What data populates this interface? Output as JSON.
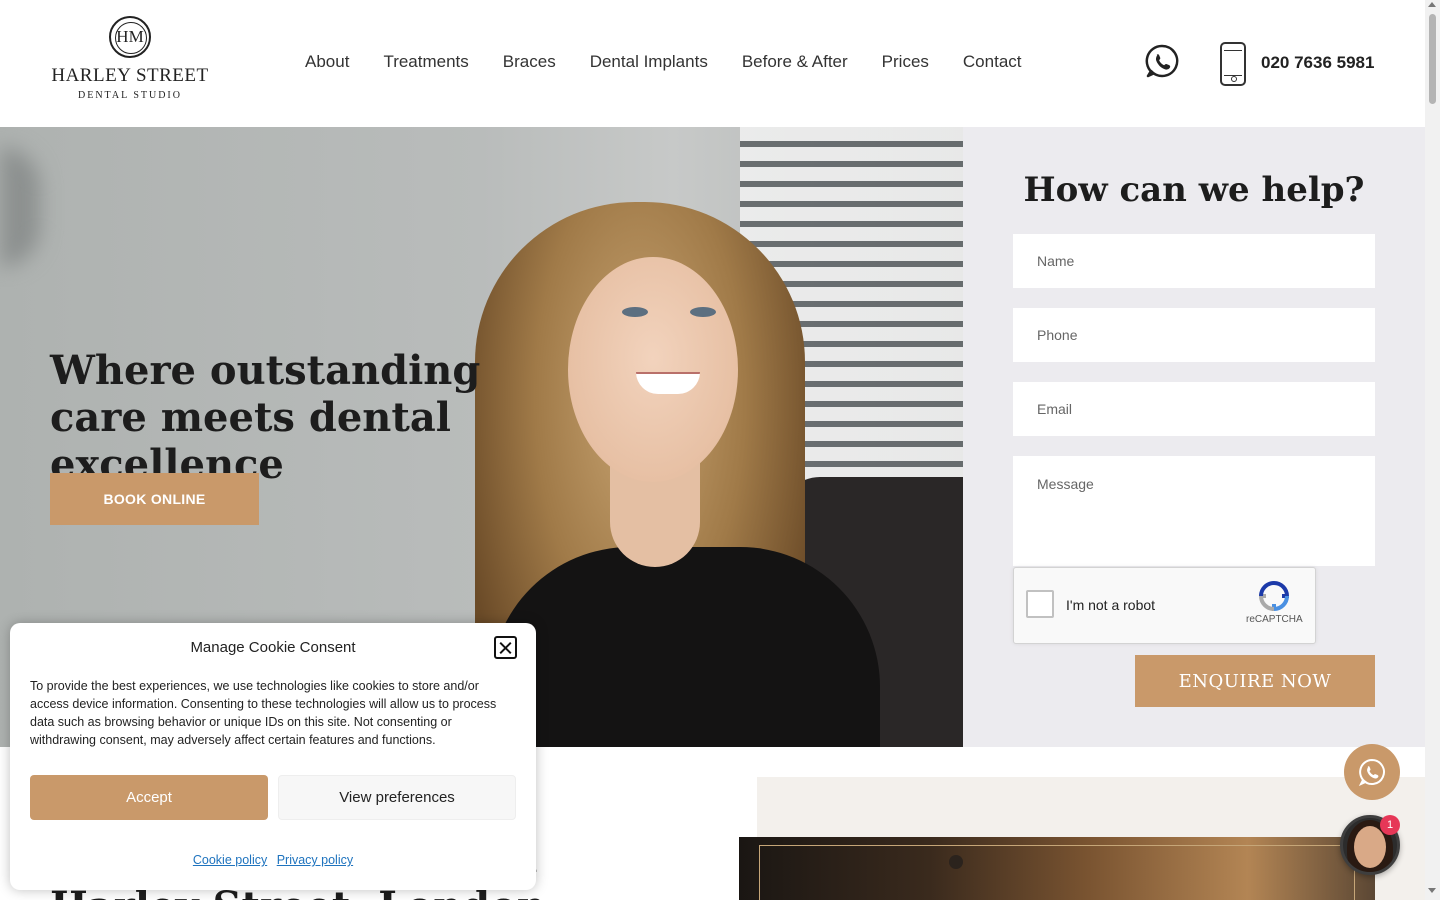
{
  "header": {
    "logo": {
      "monogram": "HM",
      "line1": "HARLEY STREET",
      "line2": "DENTAL STUDIO"
    },
    "nav": [
      {
        "label": "About"
      },
      {
        "label": "Treatments"
      },
      {
        "label": "Braces"
      },
      {
        "label": "Dental Implants"
      },
      {
        "label": "Before & After"
      },
      {
        "label": "Prices"
      },
      {
        "label": "Contact"
      }
    ],
    "phone_number": "020 7636 5981",
    "icons": {
      "whatsapp": "whatsapp-icon",
      "phone": "mobile-phone-icon"
    }
  },
  "hero": {
    "title": "Where outstanding care meets dental excellence",
    "cta_label": "BOOK ONLINE"
  },
  "form": {
    "title": "How can we help?",
    "name_placeholder": "Name",
    "phone_placeholder": "Phone",
    "email_placeholder": "Email",
    "message_placeholder": "Message",
    "recaptcha_label": "I'm not a robot",
    "recaptcha_brand": "reCAPTCHA",
    "submit_label": "ENQUIRE NOW"
  },
  "lower": {
    "heading": "Cosmetic Dentistry in Harley Street, London"
  },
  "cookie": {
    "title": "Manage Cookie Consent",
    "text": "To provide the best experiences, we use technologies like cookies to store and/or access device information. Consenting to these technologies will allow us to process data such as browsing behavior or unique IDs on this site. Not consenting or withdrawing consent, may adversely affect certain features and functions.",
    "accept_label": "Accept",
    "prefs_label": "View preferences",
    "cookie_policy": "Cookie policy",
    "privacy_policy": "Privacy policy"
  },
  "chat": {
    "badge_count": "1"
  },
  "colors": {
    "accent": "#c9996a",
    "form_bg": "#ecebef",
    "link": "#1e73be",
    "badge": "#e63757"
  }
}
